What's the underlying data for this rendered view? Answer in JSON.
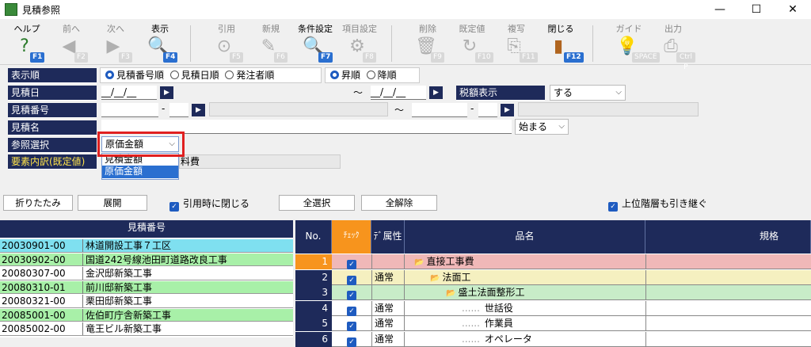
{
  "window": {
    "title": "見積参照",
    "controls": [
      "—",
      "☐",
      "✕"
    ]
  },
  "toolbar": [
    {
      "label": "ヘルプ",
      "icon": "?",
      "key": "F1",
      "enabled": true,
      "icon_color": "#2a7a2a"
    },
    {
      "label": "前へ",
      "icon": "◀",
      "key": "F2",
      "enabled": false
    },
    {
      "label": "次へ",
      "icon": "▶",
      "key": "F3",
      "enabled": false
    },
    {
      "label": "表示",
      "icon": "🔍",
      "key": "F4",
      "enabled": true,
      "icon_color": "#2a6fd0"
    },
    {
      "label": "引用",
      "icon": "⊙",
      "key": "F5",
      "enabled": false
    },
    {
      "label": "新規",
      "icon": "✎",
      "key": "F6",
      "enabled": false
    },
    {
      "label": "条件設定",
      "icon": "🔍",
      "key": "F7",
      "enabled": true,
      "icon_color": "#2a6fd0"
    },
    {
      "label": "項目設定",
      "icon": "⚙",
      "key": "F8",
      "enabled": false
    },
    {
      "label": "削除",
      "icon": "🗑",
      "key": "F9",
      "enabled": false
    },
    {
      "label": "既定値",
      "icon": "↻",
      "key": "F10",
      "enabled": false
    },
    {
      "label": "複写",
      "icon": "⎘",
      "key": "F11",
      "enabled": false
    },
    {
      "label": "閉じる",
      "icon": "▮",
      "key": "F12",
      "enabled": true,
      "icon_color": "#b0641e"
    },
    {
      "label": "ガイド",
      "icon": "💡",
      "key": "SPACE",
      "enabled": false
    },
    {
      "label": "出力",
      "icon": "⎙",
      "key": "Ctrl P",
      "enabled": false
    }
  ],
  "form": {
    "sort_label": "表示順",
    "sort_options": [
      "見積番号順",
      "見積日順",
      "発注者順"
    ],
    "sort_selected": 0,
    "order_options": [
      "昇順",
      "降順"
    ],
    "order_selected": 0,
    "date_label": "見積日",
    "date_from": "__/__/__",
    "date_to": "__/__/__",
    "range_sep": "～",
    "tax_label": "税額表示",
    "tax_value": "する",
    "number_label": "見積番号",
    "dash": "-",
    "name_label": "見積名",
    "match_value": "始まる",
    "ref_label": "参照選択",
    "ref_value": "原価金額",
    "ref_options": [
      "見積金額",
      "原価金額"
    ],
    "element_label": "要素内訳(既定値)",
    "element_value": "料費"
  },
  "actions": {
    "collapse": "折りたたみ",
    "expand": "展開",
    "close_on_cite": "引用時に閉じる",
    "select_all": "全選択",
    "deselect_all": "全解除",
    "inherit_upper": "上位階層も引き継ぐ"
  },
  "left_grid": {
    "header": "見積番号",
    "rows": [
      {
        "no": "20030901-00",
        "name": "林道開設工事７工区",
        "bg": "#7fe0f0"
      },
      {
        "no": "20030902-00",
        "name": "国道242号線池田町道路改良工事",
        "bg": "#a8f0a8"
      },
      {
        "no": "20080307-00",
        "name": "金沢邸新築工事",
        "bg": "#ffffff"
      },
      {
        "no": "20080310-01",
        "name": "前川邸新築工事",
        "bg": "#a8f0a8"
      },
      {
        "no": "20080321-00",
        "name": "栗田邸新築工事",
        "bg": "#ffffff"
      },
      {
        "no": "20085001-00",
        "name": "佐伯町庁舎新築工事",
        "bg": "#a8f0a8"
      },
      {
        "no": "20085002-00",
        "name": "竜王ビル新築工事",
        "bg": "#ffffff"
      }
    ]
  },
  "right_grid": {
    "headers": {
      "no": "No.",
      "check": "ﾁｪｯｸ",
      "attr": "ﾃﾞ属性",
      "name": "品名",
      "spec": "規格"
    },
    "rows": [
      {
        "no": "1",
        "attr": "",
        "name": "直接工事費",
        "indent": 0,
        "folder": true,
        "bg": "#f0b8b8"
      },
      {
        "no": "2",
        "attr": "通常",
        "name": "法面工",
        "indent": 1,
        "folder": true,
        "bg": "#f5f0c0"
      },
      {
        "no": "3",
        "attr": "",
        "name": "盛土法面整形工",
        "indent": 2,
        "folder": true,
        "bg": "#c8ecc8"
      },
      {
        "no": "4",
        "attr": "通常",
        "name": "世話役",
        "indent": 3,
        "folder": false,
        "bg": "#ffffff"
      },
      {
        "no": "5",
        "attr": "通常",
        "name": "作業員",
        "indent": 3,
        "folder": false,
        "bg": "#ffffff"
      },
      {
        "no": "6",
        "attr": "通常",
        "name": "オペレータ",
        "indent": 3,
        "folder": false,
        "bg": "#ffffff"
      }
    ]
  },
  "colors": {
    "header_navy": "#1e2a5a",
    "highlight_red": "#e02020",
    "key_blue": "#2a6fd0",
    "selected_orange": "#f7941d"
  }
}
